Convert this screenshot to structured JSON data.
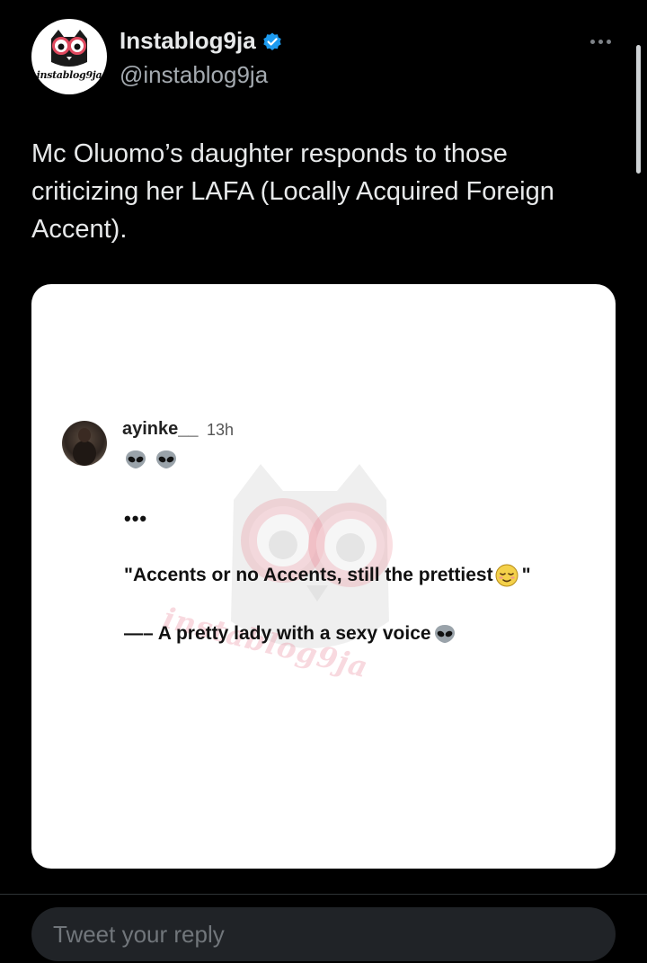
{
  "header": {
    "display_name": "Instablog9ja",
    "handle": "@instablog9ja",
    "avatar_wordmark": "instablog9ja",
    "verified_icon": "verified-badge-icon",
    "more_icon": "more-horizontal-icon",
    "verified_color": "#1d9bf0"
  },
  "tweet": {
    "text": "Mc Oluomo’s daughter responds to those criticizing her LAFA (Locally Acquired Foreign Accent)."
  },
  "media": {
    "username": "ayinke__",
    "time": "13h",
    "emoji_row": [
      "alien-face-icon",
      "alien-face-icon"
    ],
    "dots": "•••",
    "quote": "\"Accents or no Accents, still the prettiest",
    "quote_close": "\"",
    "quote_emoji": "relieved-face-icon",
    "signature": "—– A pretty lady with a sexy voice",
    "signature_emoji": "alien-face-icon",
    "watermark_text": "instablog9ja"
  },
  "reply": {
    "placeholder": "Tweet your reply"
  },
  "colors": {
    "background": "#000000",
    "primary_text": "#e7e9ea",
    "secondary_text": "#a4aab0",
    "reply_box": "#202327",
    "watermark_pink": "#e5788c"
  }
}
